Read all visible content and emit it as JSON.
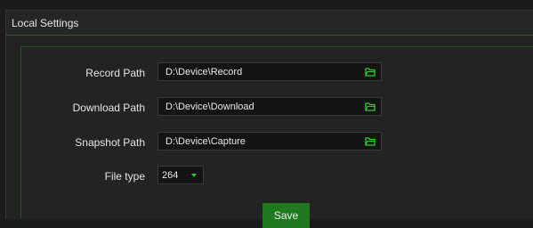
{
  "panel": {
    "title": "Local Settings"
  },
  "form": {
    "record_path": {
      "label": "Record Path",
      "value": "D:\\Device\\Record",
      "icon": "folder-icon"
    },
    "download_path": {
      "label": "Download Path",
      "value": "D:\\Device\\Download",
      "icon": "folder-icon"
    },
    "snapshot_path": {
      "label": "Snapshot Path",
      "value": "D:\\Device\\Capture",
      "icon": "folder-icon"
    },
    "file_type": {
      "label": "File type",
      "value": "264",
      "icon": "chevron-down-icon"
    },
    "save_label": "Save"
  },
  "colors": {
    "accent": "#1f7a1f",
    "icon": "#33cc33",
    "background": "#232323"
  }
}
